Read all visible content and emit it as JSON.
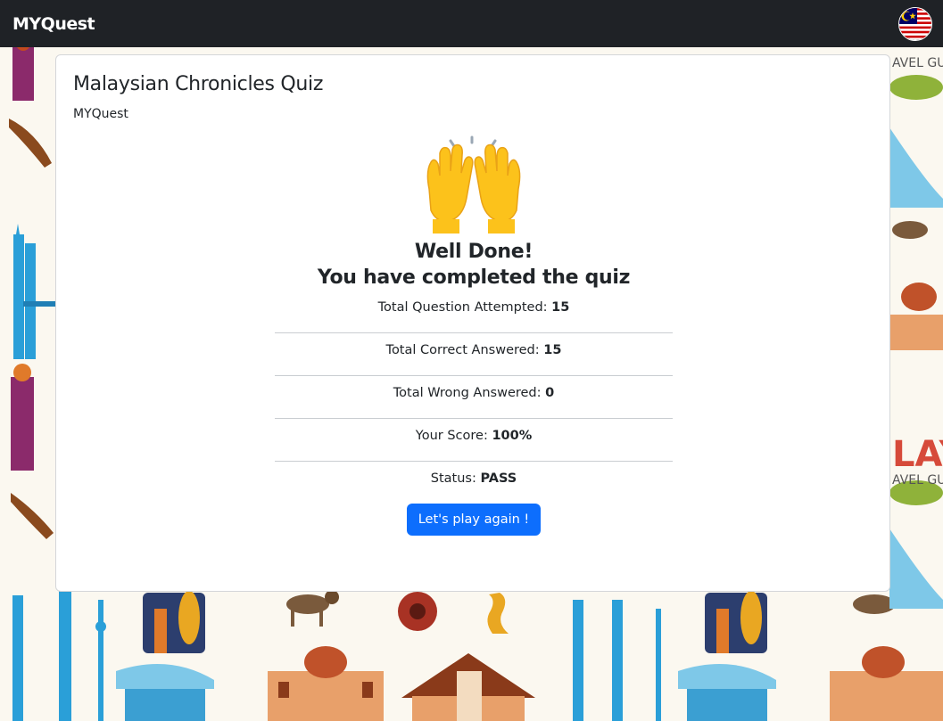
{
  "navbar": {
    "brand": "MYQuest",
    "flag_icon": "malaysia-flag-icon"
  },
  "card": {
    "title": "Malaysian Chronicles Quiz",
    "subtitle": "MYQuest",
    "emoji_icon": "raising-hands-icon",
    "headline_line1": "Well Done!",
    "headline_line2": "You have completed the quiz",
    "stats": [
      {
        "label": "Total Question Attempted: ",
        "value": "15"
      },
      {
        "label": "Total Correct Answered: ",
        "value": "15"
      },
      {
        "label": "Total Wrong Answered: ",
        "value": "0"
      },
      {
        "label": "Your Score: ",
        "value": "100%"
      },
      {
        "label": "Status: ",
        "value": "PASS"
      }
    ],
    "button_label": "Let's play again !"
  },
  "colors": {
    "navbar_bg": "#1f2226",
    "primary_button": "#0d6efd",
    "page_bg": "#fbf8f0"
  }
}
